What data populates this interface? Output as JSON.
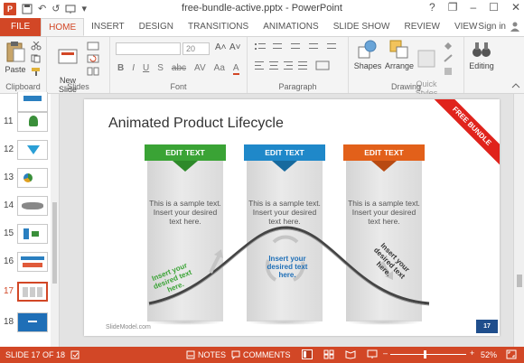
{
  "window": {
    "title": "free-bundle-active.pptx - PowerPoint",
    "controls": [
      "?",
      "❐",
      "–",
      "☐",
      "✕"
    ],
    "qat": {
      "undo": "↶",
      "redo": "↺",
      "more": "▾"
    }
  },
  "tabs": [
    {
      "label": "FILE"
    },
    {
      "label": "HOME"
    },
    {
      "label": "INSERT"
    },
    {
      "label": "DESIGN"
    },
    {
      "label": "TRANSITIONS"
    },
    {
      "label": "ANIMATIONS"
    },
    {
      "label": "SLIDE SHOW"
    },
    {
      "label": "REVIEW"
    },
    {
      "label": "VIEW"
    }
  ],
  "signin": "Sign in",
  "ribbon": {
    "clipboard": {
      "paste": "Paste",
      "label": "Clipboard"
    },
    "slides": {
      "new_slide": "New\nSlide",
      "label": "Slides"
    },
    "font": {
      "size": "20",
      "format_row": [
        "B",
        "I",
        "U",
        "S",
        "abc",
        "AV",
        "Aa",
        "A"
      ],
      "grow": "A˄",
      "shrink": "A˅",
      "label": "Font"
    },
    "paragraph": {
      "label": "Paragraph"
    },
    "drawing": {
      "shapes": "Shapes",
      "arrange": "Arrange",
      "quick_styles": "Quick\nStyles",
      "label": "Drawing"
    },
    "editing": {
      "label": "Editing"
    }
  },
  "thumbnails": [
    {
      "num": "11"
    },
    {
      "num": "12"
    },
    {
      "num": "13"
    },
    {
      "num": "14"
    },
    {
      "num": "15"
    },
    {
      "num": "16"
    },
    {
      "num": "17",
      "current": true
    },
    {
      "num": "18"
    }
  ],
  "slide": {
    "title": "Animated Product Lifecycle",
    "banner": "FREE BUNDLE",
    "cards": [
      {
        "tab": "EDIT TEXT",
        "color": "#3aa335",
        "body": "This is a sample text. Insert your desired text here."
      },
      {
        "tab": "EDIT TEXT",
        "color": "#1f88c9",
        "body": "This is a sample text. Insert your desired text here."
      },
      {
        "tab": "EDIT TEXT",
        "color": "#e2601a",
        "body": "This is a sample text. Insert your desired text here."
      }
    ],
    "curve_texts": [
      {
        "text": "Insert your desired text here.",
        "color": "#3aa335"
      },
      {
        "text": "Insert your desired text here.",
        "color": "#1f6fb7"
      },
      {
        "text": "Insert your desired text here.",
        "color": "#333333"
      }
    ],
    "brand": "SlideModel.com",
    "page_number": "17"
  },
  "status": {
    "slide_info": "SLIDE 17 OF 18",
    "notes": "NOTES",
    "comments": "COMMENTS",
    "zoom": "52%",
    "zoom_fraction": 0.52
  },
  "colors": {
    "accent": "#d24726",
    "banner": "#e0231c",
    "page_badge": "#1f4e8c"
  }
}
